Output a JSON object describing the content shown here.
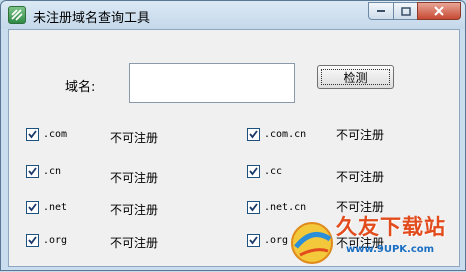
{
  "window": {
    "title": "未注册域名查询工具"
  },
  "form": {
    "domain_label": "域名:",
    "domain_value": "",
    "check_button": "检测"
  },
  "tlds": [
    {
      "label": ".com",
      "status": "不可注册",
      "checked": true
    },
    {
      "label": ".cn",
      "status": "不可注册",
      "checked": true
    },
    {
      "label": ".net",
      "status": "不可注册",
      "checked": true
    },
    {
      "label": ".org",
      "status": "不可注册",
      "checked": true
    },
    {
      "label": ".com.cn",
      "status": "不可注册",
      "checked": true
    },
    {
      "label": ".cc",
      "status": "不可注册",
      "checked": true
    },
    {
      "label": ".net.cn",
      "status": "不可注册",
      "checked": true
    },
    {
      "label": ".org",
      "status": "不可注册",
      "checked": true
    }
  ],
  "watermark": {
    "text": "久友下载站",
    "url": "www.9UPK.com"
  },
  "colors": {
    "titlebar": "#c4d8ea",
    "close_button": "#c74a33",
    "watermark_text": "#e24b1c",
    "watermark_url": "#1a6fc4"
  }
}
